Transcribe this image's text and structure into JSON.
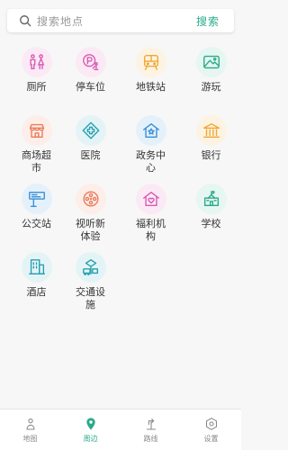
{
  "search": {
    "placeholder": "搜索地点",
    "button_label": "搜索"
  },
  "colors": {
    "accent": "#2aaa8a"
  },
  "categories": [
    {
      "label": "厕所",
      "icon": "toilet-icon",
      "bg": "#fbeaf5",
      "color": "#d85ab4"
    },
    {
      "label": "停车位",
      "icon": "parking-icon",
      "bg": "#fbeaf5",
      "color": "#d85ab4"
    },
    {
      "label": "地铁站",
      "icon": "subway-icon",
      "bg": "#fdf3e3",
      "color": "#f0a832"
    },
    {
      "label": "游玩",
      "icon": "landscape-icon",
      "bg": "#e6f6f1",
      "color": "#2aaa8a"
    },
    {
      "label": "商场超市",
      "icon": "store-icon",
      "bg": "#fdeee9",
      "color": "#ec7a5a"
    },
    {
      "label": "医院",
      "icon": "hospital-icon",
      "bg": "#e4f4f6",
      "color": "#27a0b0"
    },
    {
      "label": "政务中心",
      "icon": "government-icon",
      "bg": "#e4f1fb",
      "color": "#3a8fd6"
    },
    {
      "label": "银行",
      "icon": "bank-icon",
      "bg": "#fdf3e3",
      "color": "#f0a832"
    },
    {
      "label": "公交站",
      "icon": "bus-stop-icon",
      "bg": "#e4f1fb",
      "color": "#3a8fd6"
    },
    {
      "label": "视听新体验",
      "icon": "film-reel-icon",
      "bg": "#fdeee9",
      "color": "#ec7a5a"
    },
    {
      "label": "福利机构",
      "icon": "welfare-icon",
      "bg": "#fbeaf5",
      "color": "#d85ab4"
    },
    {
      "label": "学校",
      "icon": "school-icon",
      "bg": "#e6f6f1",
      "color": "#2aaa8a"
    },
    {
      "label": "酒店",
      "icon": "hotel-icon",
      "bg": "#e4f4f6",
      "color": "#27a0b0"
    },
    {
      "label": "交通设施",
      "icon": "transport-facility-icon",
      "bg": "#e4f4f6",
      "color": "#27a0b0"
    }
  ],
  "bottom_nav": [
    {
      "label": "地图",
      "icon": "map-person-icon",
      "active": false
    },
    {
      "label": "周边",
      "icon": "location-pin-icon",
      "active": true
    },
    {
      "label": "路线",
      "icon": "route-icon",
      "active": false
    },
    {
      "label": "设置",
      "icon": "settings-icon",
      "active": false
    }
  ]
}
